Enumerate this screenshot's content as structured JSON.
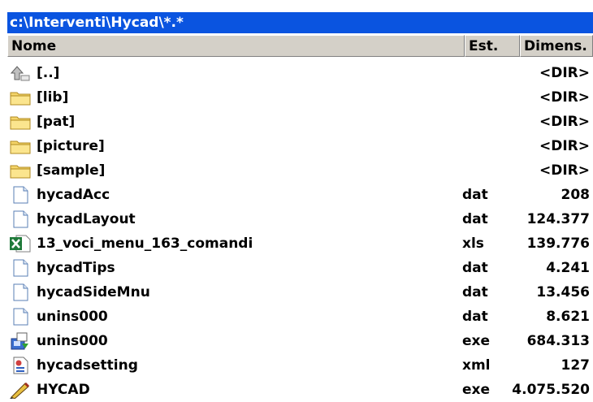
{
  "path": "c:\\Interventi\\Hycad\\*.*",
  "columns": {
    "name": "Nome",
    "ext": "Est.",
    "size": "Dimens."
  },
  "rows": [
    {
      "icon": "up-arrow-icon",
      "name": "[..]",
      "ext": "",
      "size": "<DIR>"
    },
    {
      "icon": "folder-icon",
      "name": "[lib]",
      "ext": "",
      "size": "<DIR>"
    },
    {
      "icon": "folder-icon",
      "name": "[pat]",
      "ext": "",
      "size": "<DIR>"
    },
    {
      "icon": "folder-icon",
      "name": "[picture]",
      "ext": "",
      "size": "<DIR>"
    },
    {
      "icon": "folder-icon",
      "name": "[sample]",
      "ext": "",
      "size": "<DIR>"
    },
    {
      "icon": "file-icon",
      "name": "hycadAcc",
      "ext": "dat",
      "size": "208"
    },
    {
      "icon": "file-icon",
      "name": "hycadLayout",
      "ext": "dat",
      "size": "124.377"
    },
    {
      "icon": "excel-icon",
      "name": "13_voci_menu_163_comandi",
      "ext": "xls",
      "size": "139.776"
    },
    {
      "icon": "file-icon",
      "name": "hycadTips",
      "ext": "dat",
      "size": "4.241"
    },
    {
      "icon": "file-icon",
      "name": "hycadSideMnu",
      "ext": "dat",
      "size": "13.456"
    },
    {
      "icon": "file-icon",
      "name": "unins000",
      "ext": "dat",
      "size": "8.621"
    },
    {
      "icon": "installer-icon",
      "name": "unins000",
      "ext": "exe",
      "size": "684.313"
    },
    {
      "icon": "xml-file-icon",
      "name": "hycadsetting",
      "ext": "xml",
      "size": "127"
    },
    {
      "icon": "hycad-app-icon",
      "name": "HYCAD",
      "ext": "exe",
      "size": "4.075.520"
    }
  ]
}
